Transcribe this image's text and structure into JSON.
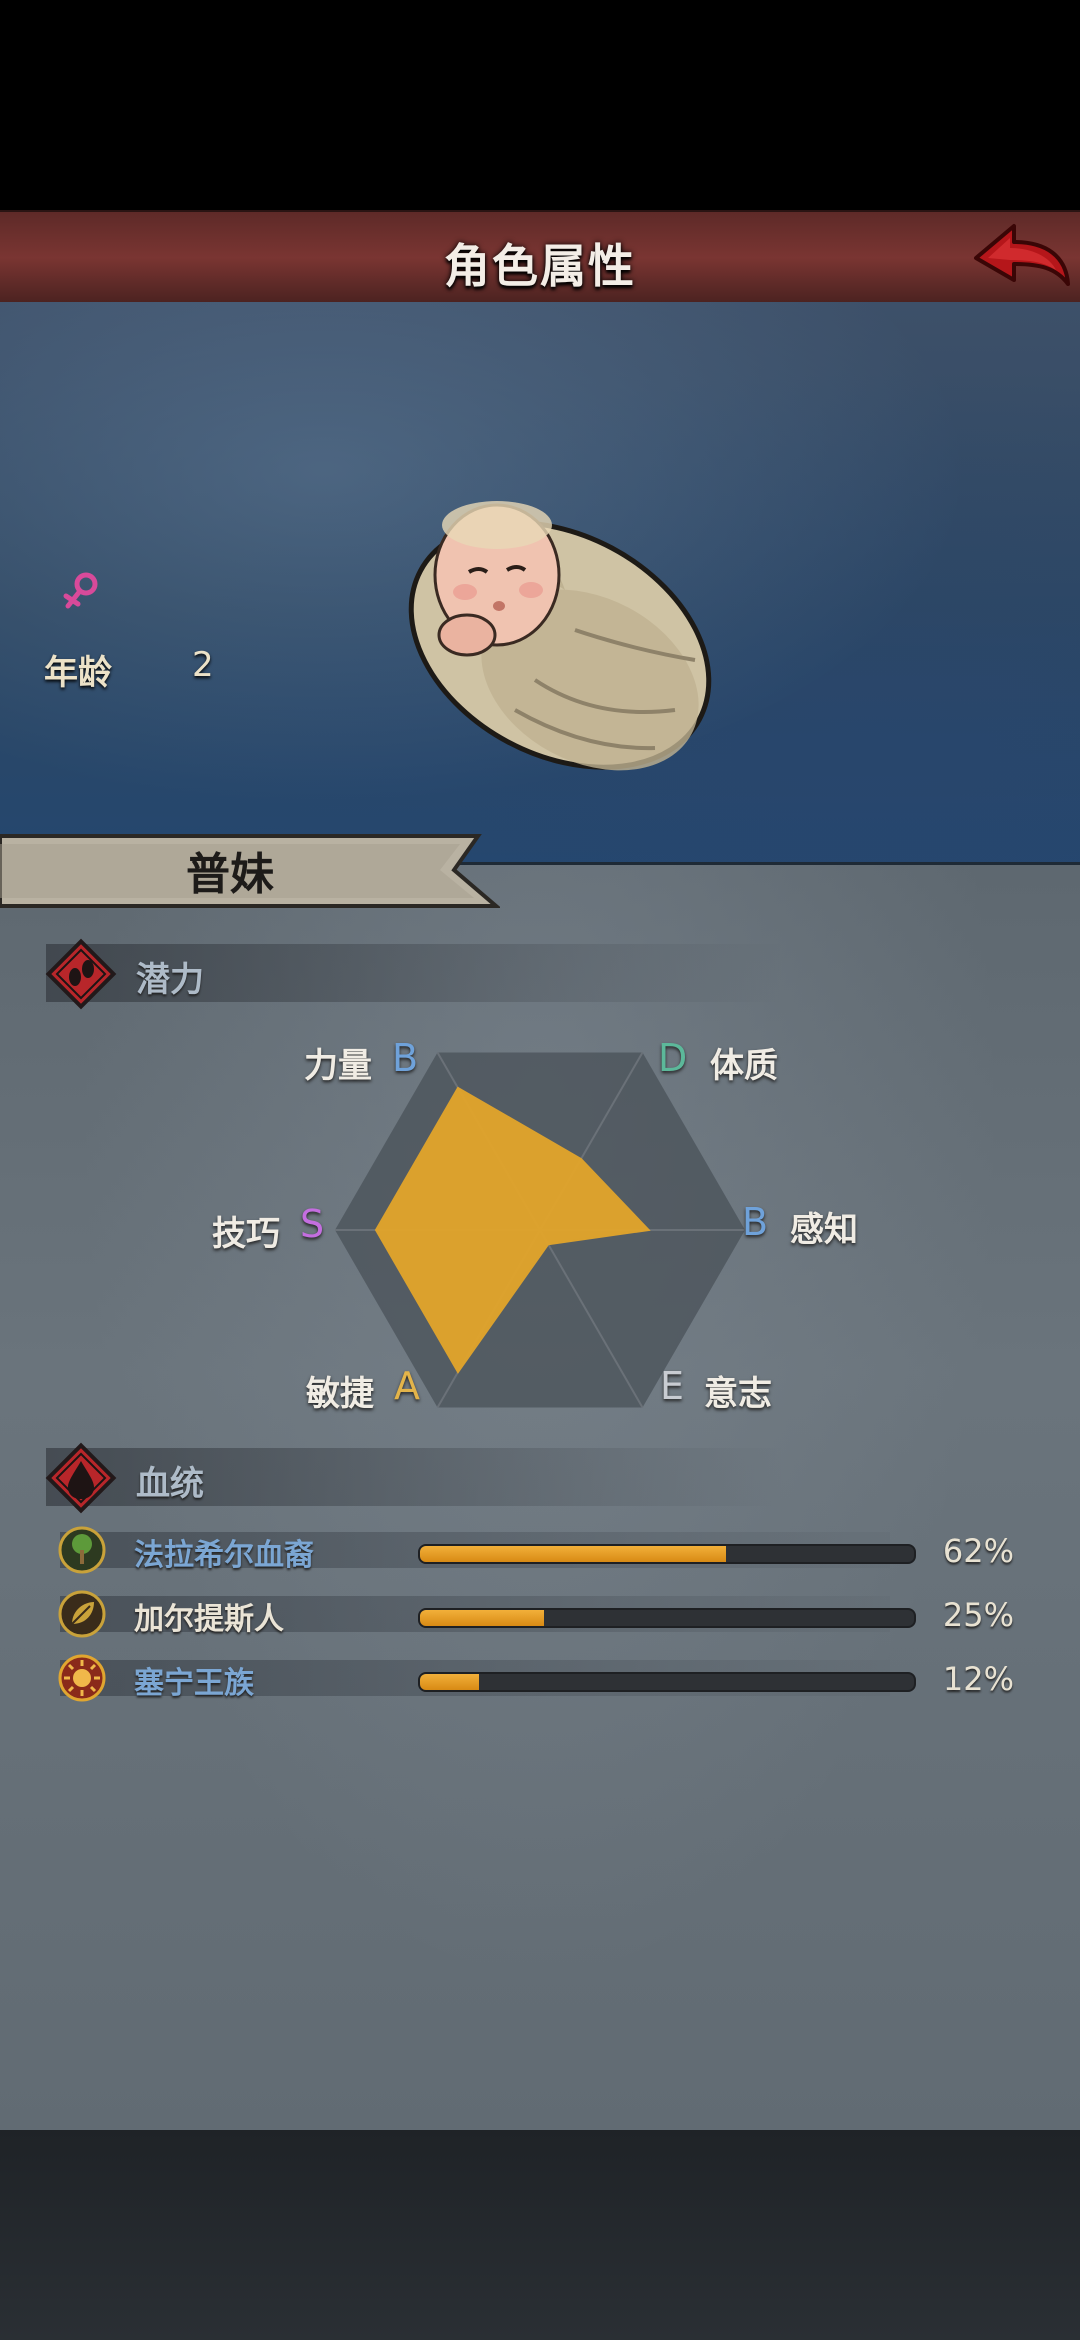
{
  "header": {
    "title": "角色属性"
  },
  "character": {
    "gender_icon": "female-symbol-icon",
    "age_label": "年龄",
    "age_value": "2",
    "name": "普妹"
  },
  "potential": {
    "title": "潜力",
    "stats": [
      {
        "label": "力量",
        "grade": "B",
        "grade_color": "#6fa2da",
        "level": 0.8
      },
      {
        "label": "体质",
        "grade": "D",
        "grade_color": "#5cb89a",
        "level": 0.4
      },
      {
        "label": "感知",
        "grade": "B",
        "grade_color": "#6fa2da",
        "level": 0.53
      },
      {
        "label": "意志",
        "grade": "E",
        "grade_color": "#c8ccd2",
        "level": 0.08
      },
      {
        "label": "敏捷",
        "grade": "A",
        "grade_color": "#e3b44a",
        "level": 0.8
      },
      {
        "label": "技巧",
        "grade": "S",
        "grade_color": "#c46ee0",
        "level": 0.8
      }
    ]
  },
  "bloodline": {
    "title": "血统",
    "items": [
      {
        "name": "法拉希尔血裔",
        "percent_label": "62%",
        "percent": 62,
        "icon": "tree-emblem-icon"
      },
      {
        "name": "加尔提斯人",
        "percent_label": "25%",
        "percent": 25,
        "icon": "leaf-emblem-icon"
      },
      {
        "name": "塞宁王族",
        "percent_label": "12%",
        "percent": 12,
        "icon": "sun-emblem-icon"
      }
    ]
  },
  "colors": {
    "accent": "#e4a52c",
    "title_bar": "#6e302d",
    "panel": "#636d75"
  }
}
